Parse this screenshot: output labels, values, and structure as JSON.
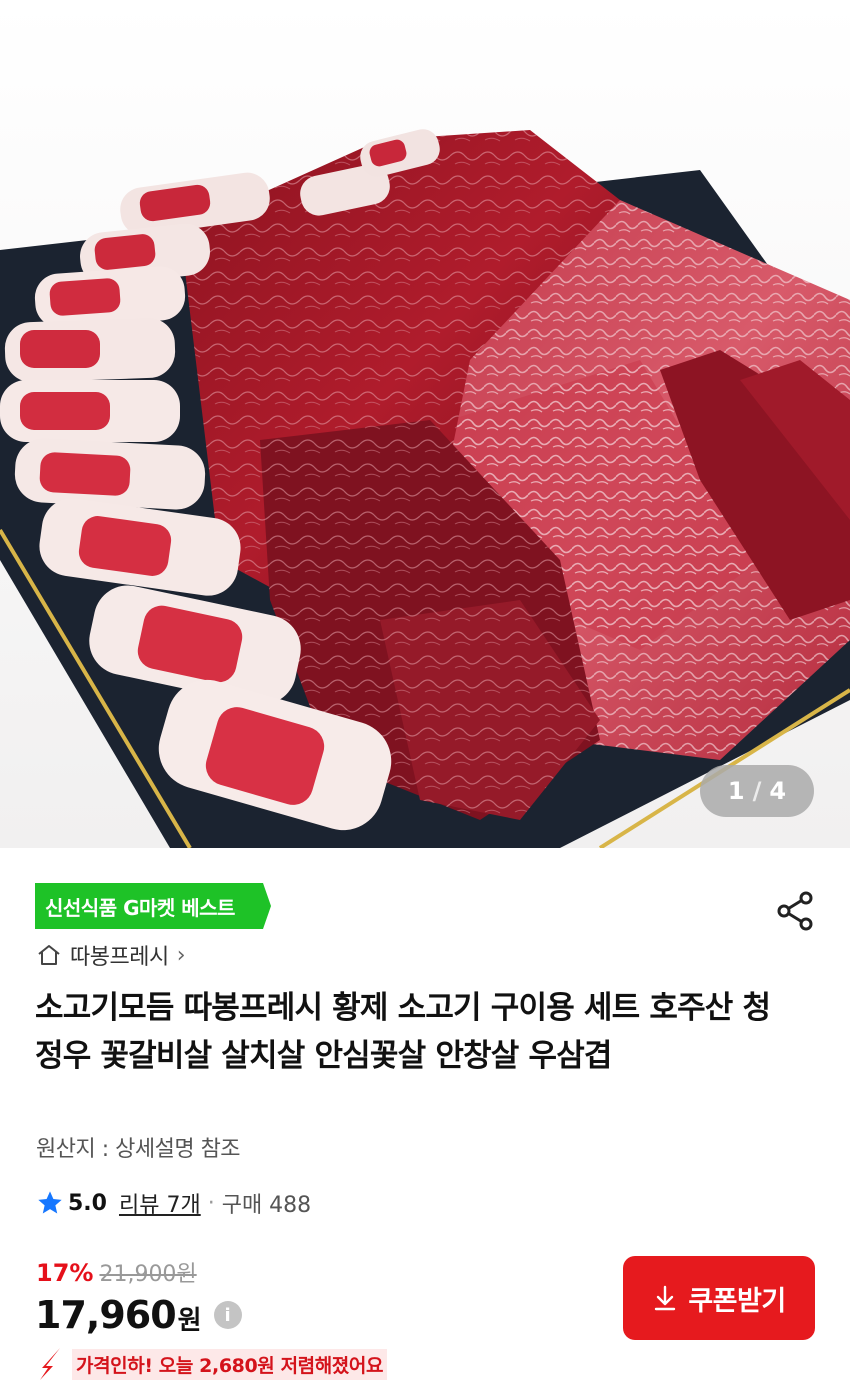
{
  "gallery": {
    "current_page": "1",
    "separator": "/",
    "total_pages": "4",
    "image_icon": "meat-platter-photo"
  },
  "product": {
    "badge": "신선식품 G마켓 베스트",
    "seller": "따봉프레시",
    "title": "소고기모듬 따봉프레시 황제 소고기 구이용 세트 호주산 청정우 꽃갈비살 살치살 안심꽃살 안창살 우삼겹",
    "origin": "원산지 : 상세설명 참조"
  },
  "rating": {
    "score": "5.0",
    "review_label": "리뷰 7개",
    "separator": "·",
    "purchase_label": "구매 488"
  },
  "pricing": {
    "discount_rate": "17%",
    "original_price": "21,900원",
    "price": "17,960",
    "currency": "원",
    "info_symbol": "i",
    "coupon_label": "쿠폰받기",
    "price_drop_message": "가격인하! 오늘 2,680원 저렴해졌어요"
  },
  "colors": {
    "accent_red": "#e61a1e",
    "badge_green": "#1ec227",
    "star_blue": "#1677ff"
  }
}
